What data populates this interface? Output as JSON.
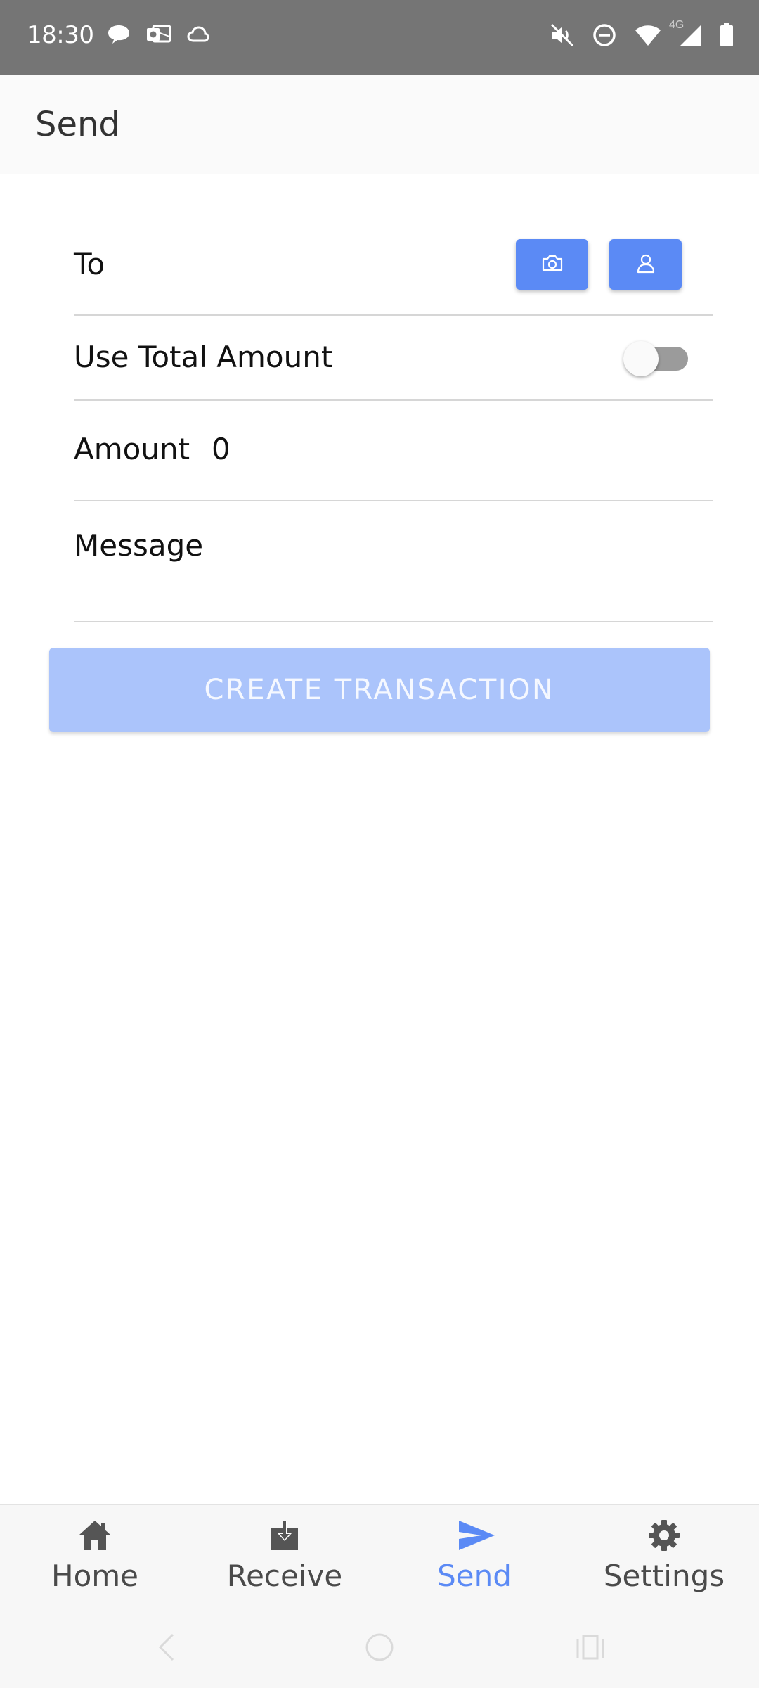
{
  "status_bar": {
    "time": "18:30",
    "network": "4G",
    "left_icons": [
      "chat-bubble-icon",
      "outlook-icon",
      "cloud-icon"
    ],
    "right_icons": [
      "mute-icon",
      "dnd-icon",
      "wifi-icon",
      "signal-icon",
      "battery-icon"
    ]
  },
  "app_bar": {
    "title": "Send"
  },
  "form": {
    "to_label": "To",
    "use_total_label": "Use Total Amount",
    "use_total_enabled": false,
    "amount_label": "Amount",
    "amount_value": "0",
    "message_label": "Message",
    "camera_icon": "camera-icon",
    "contact_icon": "contact-icon"
  },
  "create_button": {
    "label": "CREATE TRANSACTION"
  },
  "bottom_nav": {
    "items": [
      {
        "label": "Home",
        "icon": "home-icon",
        "active": false
      },
      {
        "label": "Receive",
        "icon": "receive-icon",
        "active": false
      },
      {
        "label": "Send",
        "icon": "send-icon",
        "active": true
      },
      {
        "label": "Settings",
        "icon": "settings-icon",
        "active": false
      }
    ]
  },
  "colors": {
    "accent": "#5b8af5",
    "button_disabled": "#abc4fb",
    "status_bar": "#757575",
    "app_bar": "#fafafa",
    "divider": "#d6d6d6"
  }
}
